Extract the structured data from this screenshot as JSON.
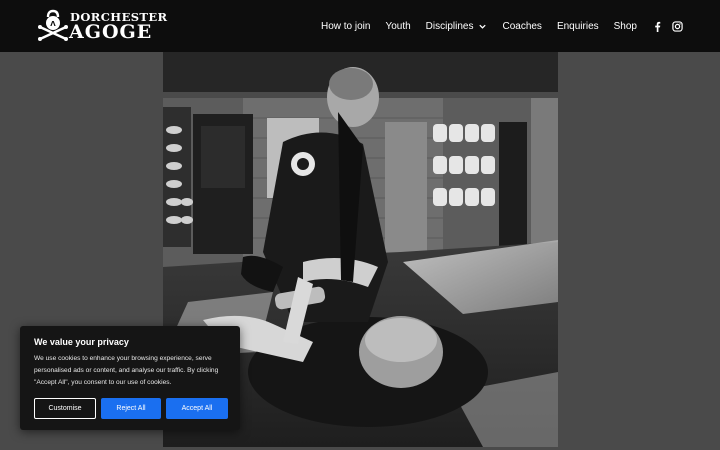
{
  "brand": {
    "name_top": "DORCHESTER",
    "name_bottom": "AGOGE"
  },
  "nav": {
    "items": [
      {
        "label": "How to join"
      },
      {
        "label": "Youth"
      },
      {
        "label": "Disciplines",
        "has_dropdown": true
      },
      {
        "label": "Coaches"
      },
      {
        "label": "Enquiries"
      },
      {
        "label": "Shop"
      }
    ],
    "social": [
      "facebook-icon",
      "instagram-icon"
    ]
  },
  "hero": {
    "image": "black-and-white-grappling-photo"
  },
  "cookie": {
    "title": "We value your privacy",
    "text": "We use cookies to enhance your browsing experience, serve personalised ads or content, and analyse our traffic. By clicking \"Accept All\", you consent to our use of cookies.",
    "customise": "Customise",
    "reject": "Reject All",
    "accept": "Accept All"
  },
  "colors": {
    "header_bg": "#0d0d0d",
    "page_bg": "#4a4a4a",
    "button_blue": "#1a6ff0"
  }
}
